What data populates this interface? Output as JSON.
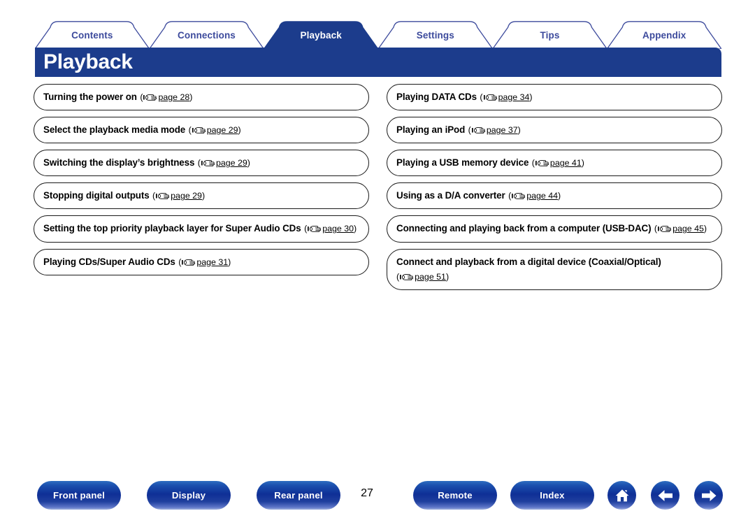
{
  "colors": {
    "header_blue": "#1c3c8c",
    "tab_text": "#3c4a9c",
    "tab_active_text": "#ffffff",
    "button_blue": "#1b4fae",
    "box_border": "#1a1a1a"
  },
  "tabs": [
    {
      "label": "Contents",
      "active": false
    },
    {
      "label": "Connections",
      "active": false
    },
    {
      "label": "Playback",
      "active": true
    },
    {
      "label": "Settings",
      "active": false
    },
    {
      "label": "Tips",
      "active": false
    },
    {
      "label": "Appendix",
      "active": false
    }
  ],
  "header": {
    "title": "Playback"
  },
  "ref_icon_name": "pointing-hand-icon",
  "content": {
    "left_column": [
      {
        "title": "Turning the power on",
        "ref_open": "(",
        "page": "page 28",
        "ref_close": ")"
      },
      {
        "title": "Select the playback media mode",
        "ref_open": "(",
        "page": "page 29",
        "ref_close": ")"
      },
      {
        "title": "Switching the display’s brightness",
        "ref_open": "(",
        "page": "page 29",
        "ref_close": ")"
      },
      {
        "title": "Stopping digital outputs",
        "ref_open": "(",
        "page": "page 29",
        "ref_close": ")"
      },
      {
        "title": "Setting the top priority playback layer for Super Audio CDs",
        "ref_open": "(",
        "page": "page 30",
        "ref_close": ")"
      },
      {
        "title": "Playing CDs/Super Audio CDs",
        "ref_open": "(",
        "page": "page 31",
        "ref_close": ")"
      }
    ],
    "right_column": [
      {
        "title": "Playing DATA CDs",
        "ref_open": "(",
        "page": "page 34",
        "ref_close": ")"
      },
      {
        "title": "Playing an iPod",
        "ref_open": "(",
        "page": "page 37",
        "ref_close": ")"
      },
      {
        "title": "Playing a USB memory device",
        "ref_open": "(",
        "page": "page 41",
        "ref_close": ")"
      },
      {
        "title": "Using as a D/A converter",
        "ref_open": "(",
        "page": "page 44",
        "ref_close": ")"
      },
      {
        "title": "Connecting and playing back from a computer (USB-DAC)",
        "ref_open": "(",
        "page": "page 45",
        "ref_close": ")"
      },
      {
        "title": "Connect and playback from a digital device (Coaxial/Optical)",
        "ref_open": "(",
        "page": "page 51",
        "ref_close": ")"
      }
    ]
  },
  "footer": {
    "buttons": [
      {
        "label": "Front panel"
      },
      {
        "label": "Display"
      },
      {
        "label": "Rear panel"
      },
      {
        "label": "Remote"
      },
      {
        "label": "Index"
      }
    ],
    "page_number": "27",
    "icon_buttons": [
      {
        "name": "home-icon"
      },
      {
        "name": "arrow-left-icon"
      },
      {
        "name": "arrow-right-icon"
      }
    ]
  }
}
